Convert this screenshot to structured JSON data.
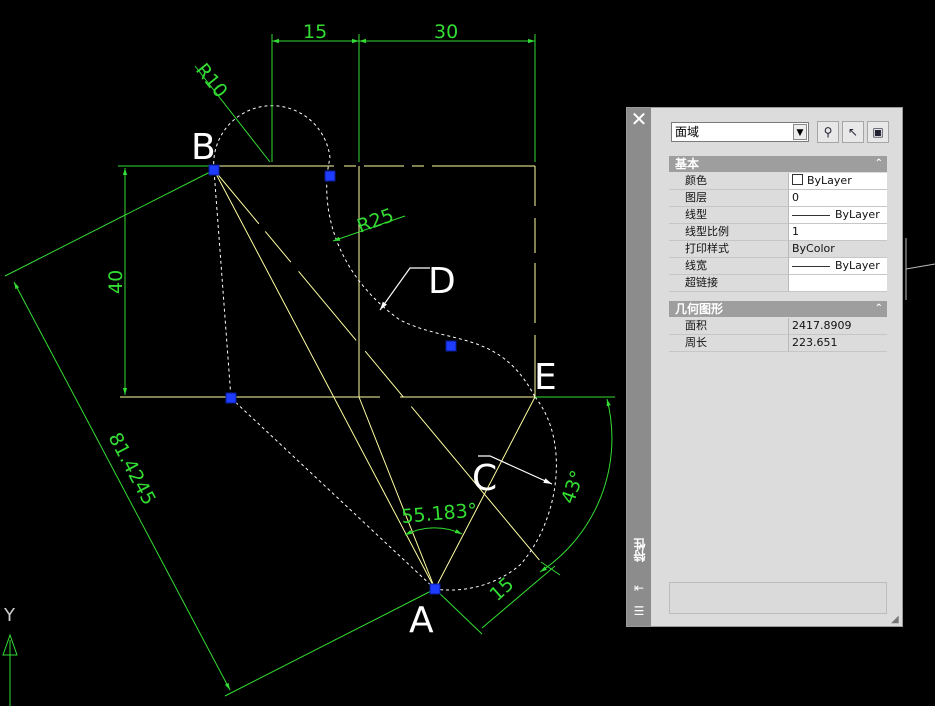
{
  "drawing": {
    "dimensions": {
      "top_left": "15",
      "top_right": "30",
      "r10": "R10",
      "r25": "R25",
      "height": "40",
      "diagonal": "81.4245",
      "angle_a": "55.183°",
      "angle_right": "43°",
      "bottom_right": "15"
    },
    "points": {
      "a": "A",
      "b": "B",
      "c": "C",
      "d": "D",
      "e": "E"
    },
    "ucs": {
      "y": "Y"
    }
  },
  "palette": {
    "close_icon": "✕",
    "title": "特性",
    "object_type": "面域",
    "sections": {
      "basic": {
        "title": "基本",
        "rows": [
          {
            "key": "颜色",
            "value": "ByLayer"
          },
          {
            "key": "图层",
            "value": "0"
          },
          {
            "key": "线型",
            "value": "ByLayer"
          },
          {
            "key": "线型比例",
            "value": "1"
          },
          {
            "key": "打印样式",
            "value": "ByColor"
          },
          {
            "key": "线宽",
            "value": "ByLayer"
          },
          {
            "key": "超链接",
            "value": ""
          }
        ]
      },
      "geometry": {
        "title": "几何图形",
        "rows": [
          {
            "key": "面积",
            "value": "2417.8909"
          },
          {
            "key": "周长",
            "value": "223.651"
          }
        ]
      }
    }
  },
  "colors": {
    "dimension": "#33dd33",
    "object": "#ffffa0",
    "grip": "#1e3cff",
    "background": "#000000"
  }
}
